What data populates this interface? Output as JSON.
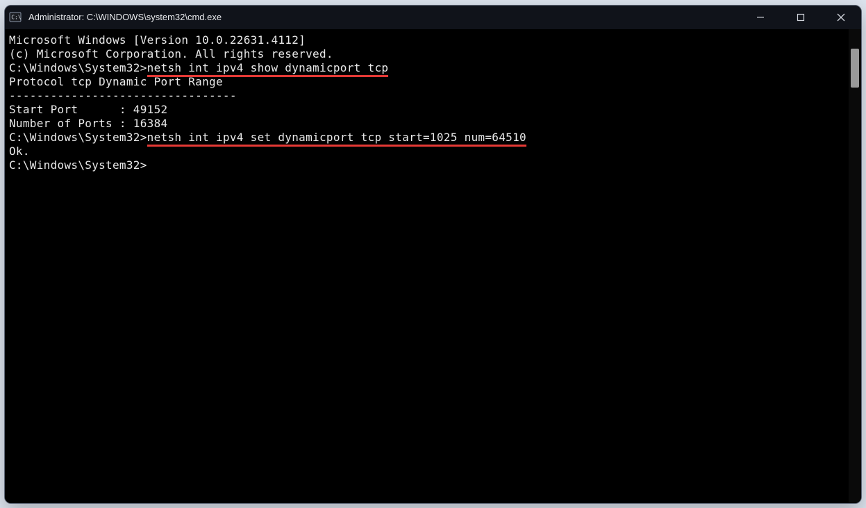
{
  "window": {
    "title": "Administrator: C:\\WINDOWS\\system32\\cmd.exe"
  },
  "terminal": {
    "banner1": "Microsoft Windows [Version 10.0.22631.4112]",
    "banner2": "(c) Microsoft Corporation. All rights reserved.",
    "prompt1": "C:\\Windows\\System32>",
    "cmd1": "netsh int ipv4 show dynamicport tcp",
    "out1_header": "Protocol tcp Dynamic Port Range",
    "out1_sep": "---------------------------------",
    "out1_start": "Start Port      : 49152",
    "out1_num": "Number of Ports : 16384",
    "prompt2": "C:\\Windows\\System32>",
    "cmd2": "netsh int ipv4 set dynamicport tcp start=1025 num=64510",
    "out2": "Ok.",
    "prompt3": "C:\\Windows\\System32>"
  }
}
